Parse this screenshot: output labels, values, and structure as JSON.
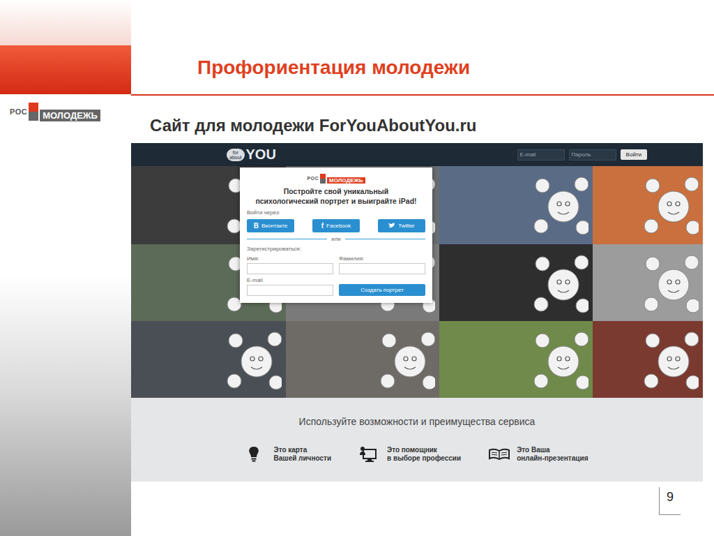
{
  "slide": {
    "title": "Профориентация молодежи",
    "subtitle": "Сайт для молодежи ForYouAboutYou.ru",
    "page": "9"
  },
  "logo": {
    "prefix": "РОС",
    "name": "МОЛОДЕЖЬ"
  },
  "site": {
    "logo": {
      "small_top": "for",
      "small_bottom": "about",
      "big": "YOU"
    },
    "login": {
      "email_placeholder": "E-mail",
      "password_placeholder": "Пароль",
      "button": "Войти"
    },
    "modal": {
      "logo": {
        "prefix": "РОС",
        "name": "МОЛОДЕЖЬ"
      },
      "headline": [
        "Постройте свой уникальный",
        "психологический портрет и выиграйте iPad!"
      ],
      "social_label": "Войти через:",
      "social": [
        {
          "label": "Вконтакте",
          "icon": "B"
        },
        {
          "label": "Facebook",
          "icon": "f"
        },
        {
          "label": "Twitter"
        }
      ],
      "divider": "или",
      "register_label": "Зарегистрироваться:",
      "fields": [
        {
          "label": "Имя:"
        },
        {
          "label": "Фамилия:"
        },
        {
          "label": "E-mail"
        }
      ],
      "submit": "Создать портрет"
    },
    "tagline": "Используйте возможности и преимущества сервиса",
    "features": [
      {
        "lines": [
          "Это карта",
          "Вашей личности"
        ]
      },
      {
        "lines": [
          "Это помощник",
          "в выборе профессии"
        ]
      },
      {
        "lines": [
          "Это Ваша",
          "онлайн-презентация"
        ]
      }
    ]
  }
}
